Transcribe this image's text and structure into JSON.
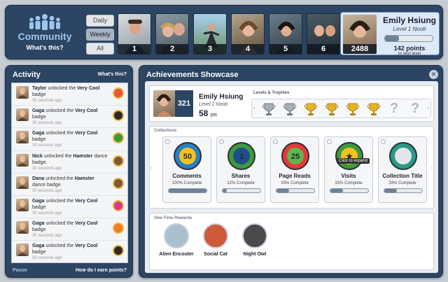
{
  "header": {
    "brand_name": "Community",
    "brand_link": "What's this?",
    "periods": [
      "Daily",
      "Weekly",
      "All"
    ],
    "selected_period": "Weekly",
    "leaders": [
      "1",
      "2",
      "3",
      "4",
      "5",
      "6"
    ],
    "user": {
      "name": "Emily Hsiung",
      "level": "Level 1 Noob",
      "points_total": "2488",
      "progress_fraction": 0.3,
      "points_needed": "142 points",
      "points_needed_caption": "to next level"
    }
  },
  "activity": {
    "title": "Activity",
    "help_link": "What's this?",
    "items": [
      {
        "user": "Taylor",
        "action": "unlocked the",
        "badge": "Very Cool",
        "suffix": "badge",
        "time": "30 seconds ago",
        "badge_color": "#e8553b"
      },
      {
        "user": "Gaga",
        "action": "unlocked the",
        "badge": "Very Cool",
        "suffix": "badge",
        "time": "30 seconds ago",
        "badge_color": "#2e2a28"
      },
      {
        "user": "Gaga",
        "action": "unlocked the",
        "badge": "Very Cool",
        "suffix": "badge",
        "time": "30 seconds ago",
        "badge_color": "#3c9a3a"
      },
      {
        "user": "Nick",
        "action": "unlocked the",
        "badge": "Hamster",
        "suffix": "dance badge.",
        "time": "30 seconds ago",
        "badge_color": "#7b5a3a"
      },
      {
        "user": "Dana",
        "action": "unlocked the",
        "badge": "Hamster",
        "suffix": "dance badge.",
        "time": "30 seconds ago",
        "badge_color": "#7b5a3a"
      },
      {
        "user": "Gaga",
        "action": "unlocked the",
        "badge": "Very Cool",
        "suffix": "badge",
        "time": "30 seconds ago",
        "badge_color": "#d83a8c"
      },
      {
        "user": "Gaga",
        "action": "unlocked the",
        "badge": "Very Cool",
        "suffix": "badge",
        "time": "30 seconds ago",
        "badge_color": "#ef7a2a"
      },
      {
        "user": "Gaga",
        "action": "unlocked the",
        "badge": "Very Cool",
        "suffix": "badge",
        "time": "30 seconds ago",
        "badge_color": "#2e2a28"
      }
    ],
    "pause_label": "Pause",
    "earn_link": "How do I earn points?"
  },
  "showcase": {
    "title": "Achievements Showcase",
    "profile": {
      "badge_count": "321",
      "name": "Emily Hsiung",
      "level": "Level 1 Noob",
      "points": "58",
      "points_unit": "pts"
    },
    "levels_title": "Levels & Trophies",
    "levels": [
      "silver",
      "silver",
      "gold",
      "gold",
      "gold",
      "gold",
      "locked",
      "locked"
    ],
    "collections_title": "Collections",
    "collections": [
      {
        "title": "Comments",
        "complete": "100% Complete",
        "progress": 1.0,
        "icon": "megaphone-icon",
        "bg": "#2a7fc4",
        "fg": "#f4c21f",
        "mark": "50"
      },
      {
        "title": "Shares",
        "complete": "12% Complete",
        "progress": 0.12,
        "icon": "antenna-icon",
        "bg": "#3e9a3c",
        "fg": "#1f4f8a",
        "mark": "1"
      },
      {
        "title": "Page Reads",
        "complete": "33% Complete",
        "progress": 0.33,
        "icon": "target-icon",
        "bg": "#e8373b",
        "fg": "#5db84b",
        "mark": "25"
      },
      {
        "title": "Visits",
        "complete": "33% Complete",
        "progress": 0.33,
        "icon": "star-icon",
        "bg": "#3e9a3c",
        "fg": "#f4c21f",
        "mark": "★"
      },
      {
        "title": "Collection Title",
        "complete": "33% Complete",
        "progress": 0.33,
        "icon": "certificate-icon",
        "bg": "#2a9a8a",
        "fg": "#e2e6ea",
        "mark": ""
      }
    ],
    "tooltip": "Click to expand",
    "rewards_title": "One-Time Rewards",
    "rewards": [
      {
        "title": "Alien Encouter",
        "icon": "alien-icon",
        "color": "#a9c1cf"
      },
      {
        "title": "Social Cat",
        "icon": "cat-icon",
        "color": "#cf5a3a"
      },
      {
        "title": "Night Owl",
        "icon": "owl-icon",
        "color": "#4a4a4a"
      }
    ]
  }
}
